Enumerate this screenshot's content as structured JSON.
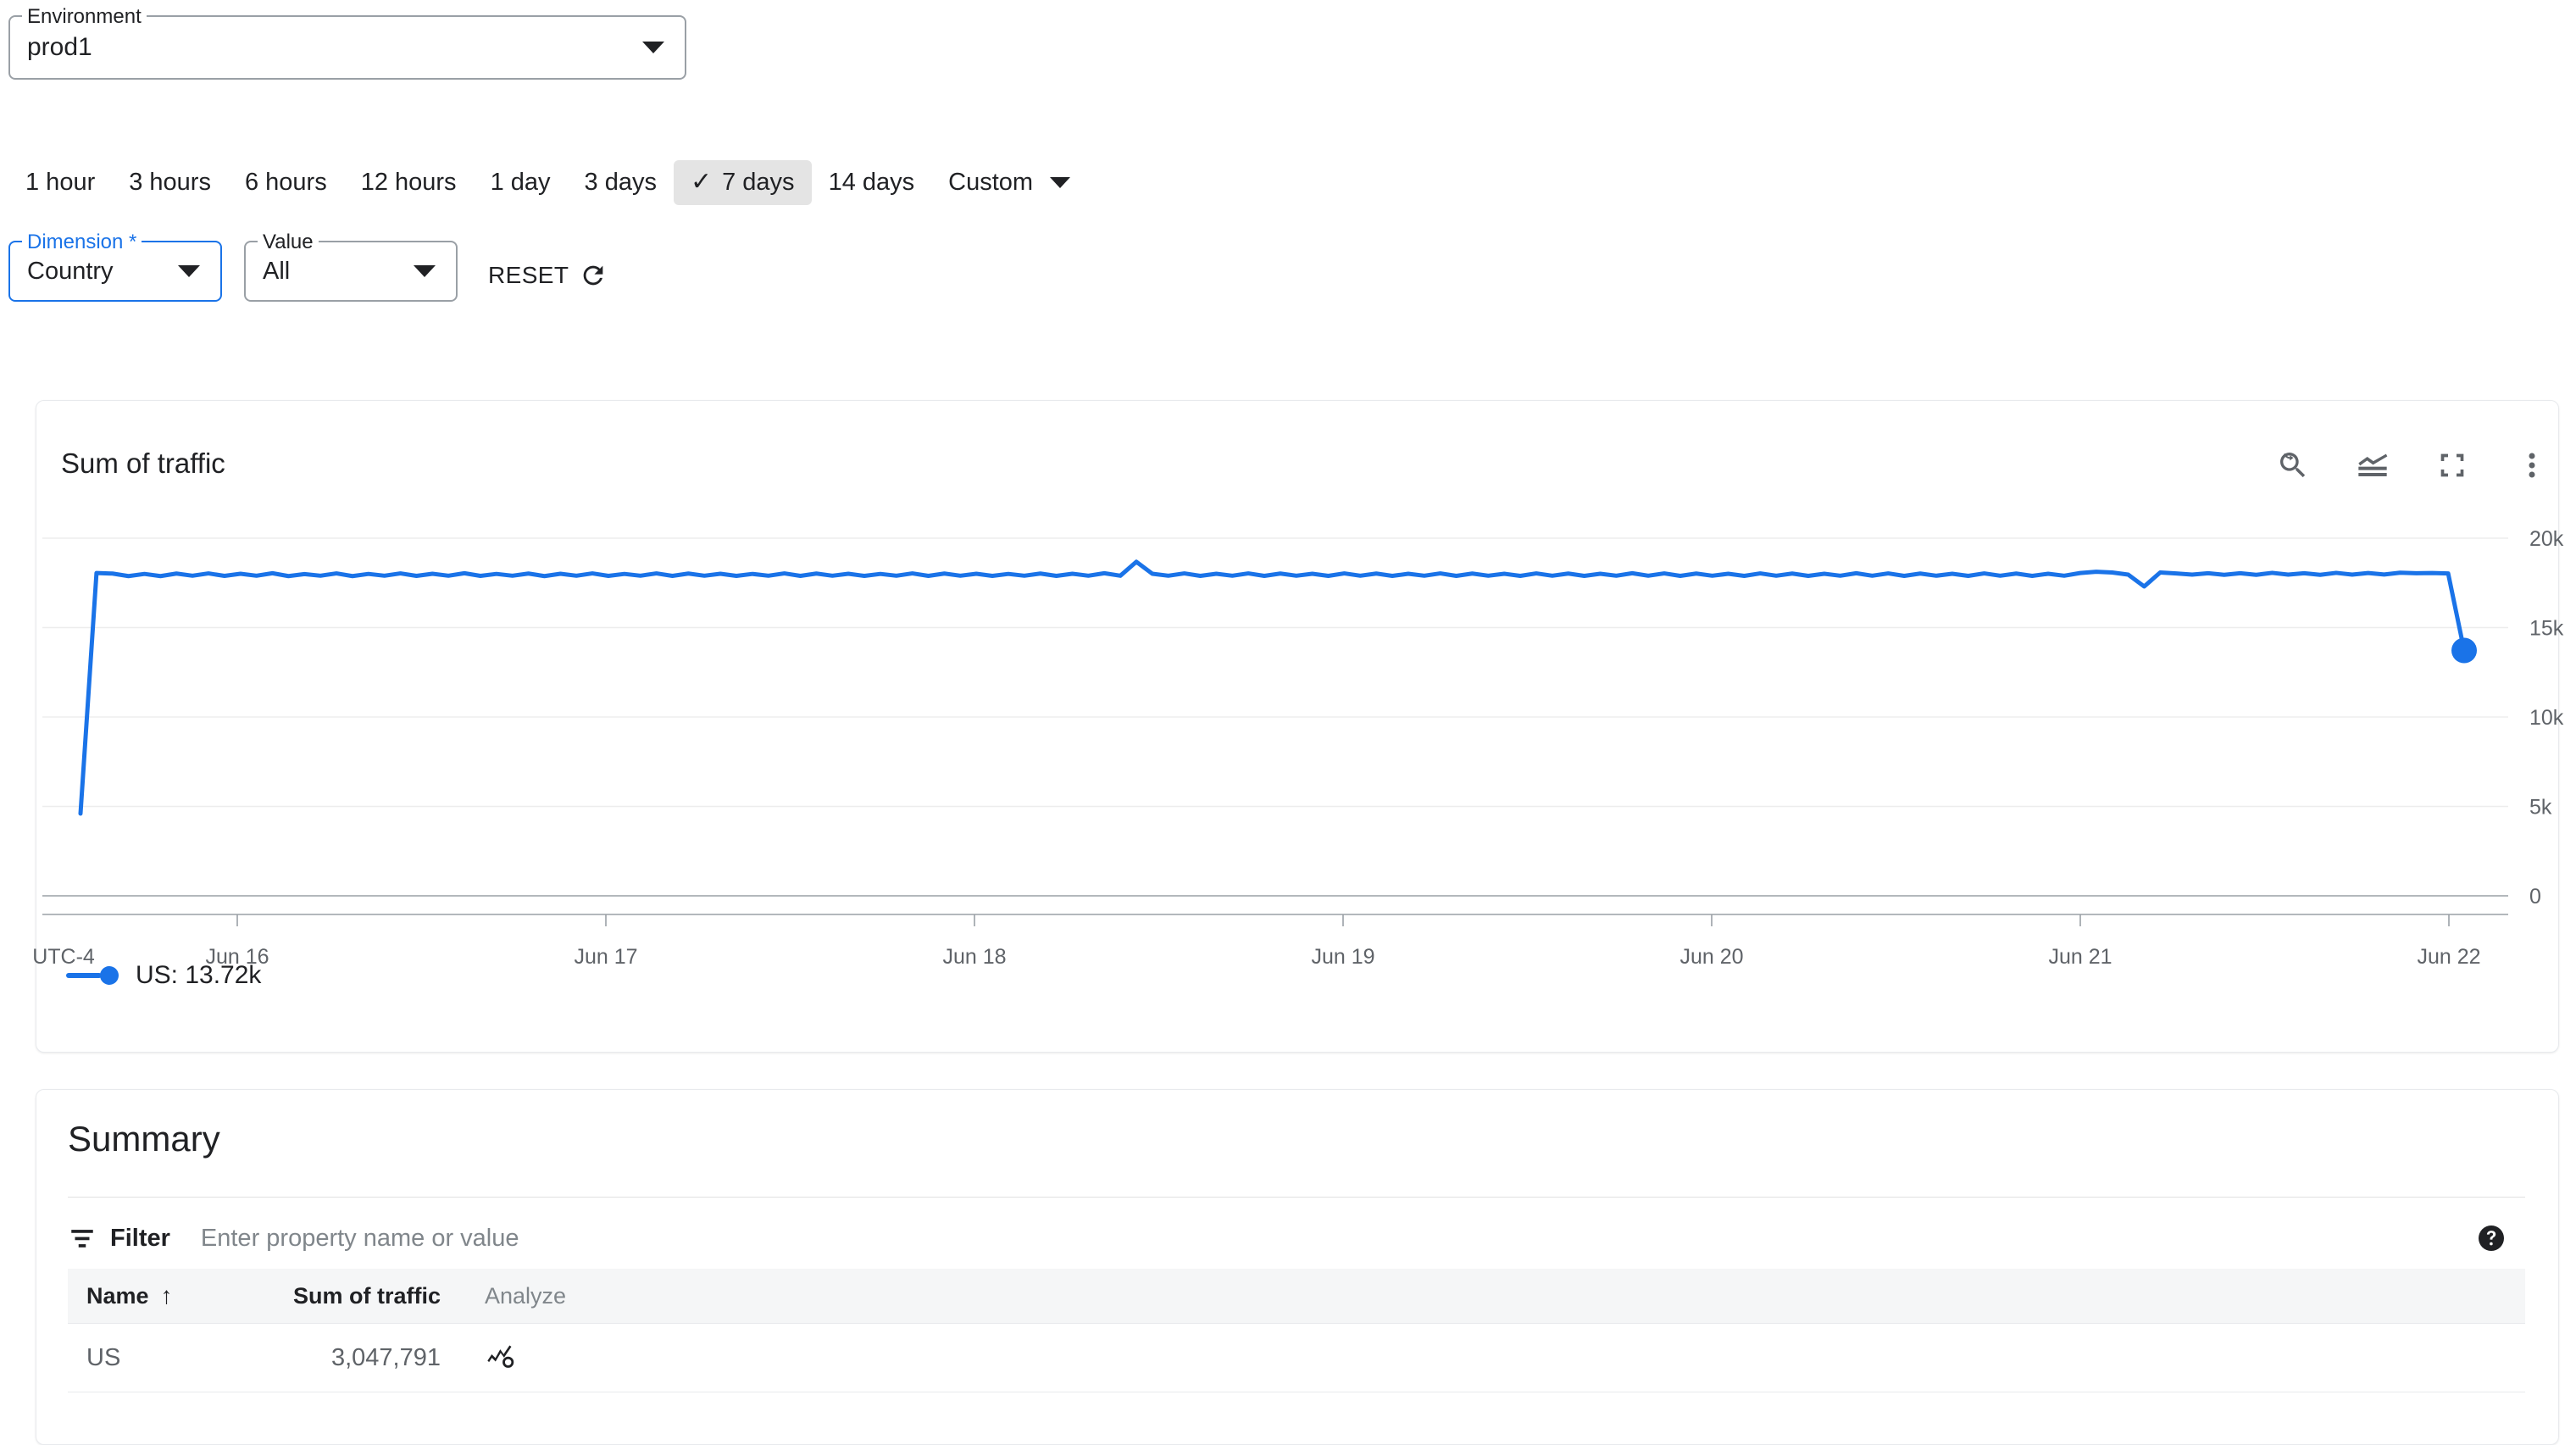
{
  "environment": {
    "label": "Environment",
    "value": "prod1",
    "caret_icon": "chevron-down-icon"
  },
  "time_range": {
    "options": [
      {
        "label": "1 hour",
        "selected": false
      },
      {
        "label": "3 hours",
        "selected": false
      },
      {
        "label": "6 hours",
        "selected": false
      },
      {
        "label": "12 hours",
        "selected": false
      },
      {
        "label": "1 day",
        "selected": false
      },
      {
        "label": "3 days",
        "selected": false
      },
      {
        "label": "7 days",
        "selected": true
      },
      {
        "label": "14 days",
        "selected": false
      }
    ],
    "check_glyph": "✓",
    "custom_label": "Custom"
  },
  "filters": {
    "dimension": {
      "label": "Dimension *",
      "value": "Country",
      "focused": true
    },
    "value": {
      "label": "Value",
      "value": "All",
      "focused": false
    },
    "reset_label": "RESET",
    "reset_icon": "refresh-icon"
  },
  "chart_card": {
    "title": "Sum of traffic",
    "tools": [
      {
        "name": "zoom-reset-icon",
        "title": "Reset zoom"
      },
      {
        "name": "chart-type-icon",
        "title": "Chart type"
      },
      {
        "name": "fullscreen-icon",
        "title": "Fullscreen"
      },
      {
        "name": "more-options-icon",
        "title": "More options"
      }
    ],
    "legend": [
      {
        "series": "US",
        "label": "US: 13.72k",
        "color": "#1a73e8"
      }
    ]
  },
  "summary": {
    "title": "Summary",
    "filter_label": "Filter",
    "filter_icon": "filter-icon",
    "filter_placeholder": "Enter property name or value",
    "filter_value": "",
    "help_icon": "help-icon",
    "columns": [
      {
        "key": "name",
        "label": "Name",
        "sorted": "asc",
        "sort_glyph": "↑"
      },
      {
        "key": "sum",
        "label": "Sum of traffic"
      },
      {
        "key": "analyze",
        "label": "Analyze"
      }
    ],
    "rows": [
      {
        "name": "US",
        "sum": "3,047,791",
        "analyze_icon": "analyze-chart-icon"
      }
    ]
  },
  "colors": {
    "accent": "#1a73e8",
    "series_us": "#1a73e8",
    "chip_selected_bg": "#e4e4e4",
    "axis_text": "#5f6368",
    "gridline": "#ededed"
  },
  "chart_data": {
    "type": "line",
    "title": "Sum of traffic",
    "xlabel": "",
    "ylabel": "",
    "timezone_label": "UTC-4",
    "grid": true,
    "legend_position": "bottom-left",
    "ylim": [
      0,
      20000
    ],
    "yticks": [
      0,
      5000,
      10000,
      15000,
      20000
    ],
    "ytick_labels": [
      "0",
      "5k",
      "10k",
      "15k",
      "20k"
    ],
    "xtick_labels": [
      "Jun 16",
      "Jun 17",
      "Jun 18",
      "Jun 19",
      "Jun 20",
      "Jun 21",
      "Jun 22"
    ],
    "series": [
      {
        "name": "US",
        "color": "#1a73e8",
        "last_value_label": "13.72k",
        "last_value": 13720,
        "total": 3047791,
        "values": [
          4600,
          18050,
          18020,
          17880,
          18000,
          17880,
          18020,
          17900,
          18030,
          17890,
          18010,
          17900,
          18040,
          17880,
          17990,
          17900,
          18030,
          17880,
          18000,
          17900,
          18030,
          17890,
          18010,
          17900,
          18040,
          17890,
          18000,
          17900,
          18020,
          17880,
          18010,
          17900,
          18030,
          17890,
          18000,
          17900,
          18030,
          17890,
          18020,
          17900,
          18010,
          17890,
          18000,
          17900,
          18030,
          17890,
          18020,
          17900,
          18010,
          17890,
          18000,
          17900,
          18030,
          17890,
          18020,
          17900,
          18010,
          17890,
          18000,
          17900,
          18020,
          17890,
          18010,
          17900,
          18040,
          17900,
          18680,
          18010,
          17900,
          18030,
          17890,
          18010,
          17900,
          18030,
          17890,
          18020,
          17900,
          18010,
          17890,
          18030,
          17900,
          18020,
          17890,
          18010,
          17900,
          18030,
          17890,
          18020,
          17900,
          18010,
          17890,
          18030,
          17900,
          18020,
          17890,
          18010,
          17900,
          18040,
          17900,
          18030,
          17890,
          18020,
          17900,
          18010,
          17890,
          18030,
          17900,
          18020,
          17890,
          18010,
          17900,
          18040,
          17900,
          18030,
          17890,
          18020,
          17900,
          18010,
          17890,
          18030,
          17900,
          18020,
          17890,
          18010,
          17900,
          18050,
          18120,
          18080,
          17960,
          17300,
          18080,
          18030,
          17960,
          18040,
          17950,
          18040,
          17950,
          18060,
          17960,
          18040,
          17950,
          18060,
          17960,
          18050,
          17970,
          18070,
          18040,
          18050,
          18030,
          13720
        ]
      }
    ]
  }
}
